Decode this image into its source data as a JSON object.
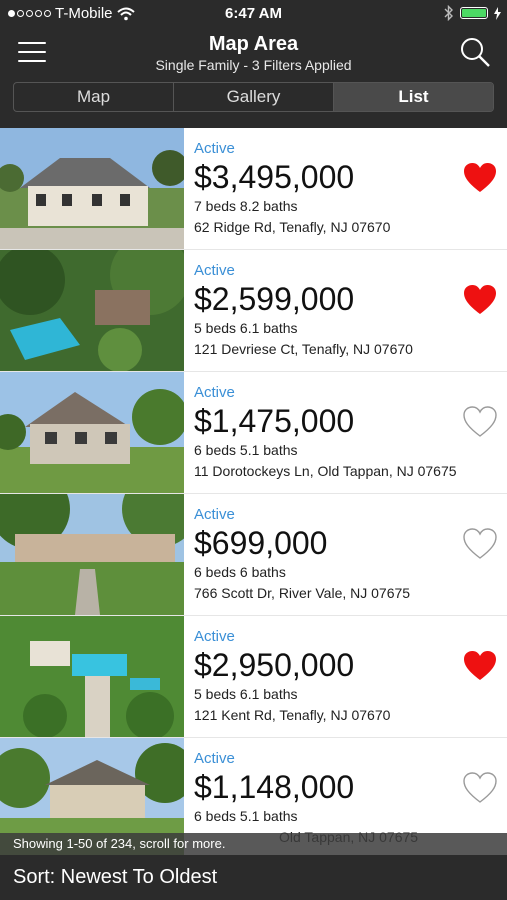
{
  "status_bar": {
    "carrier": "T-Mobile",
    "time": "6:47 AM"
  },
  "header": {
    "title": "Map Area",
    "subtitle": "Single Family - 3 Filters Applied",
    "tabs": [
      {
        "label": "Map",
        "selected": false
      },
      {
        "label": "Gallery",
        "selected": false
      },
      {
        "label": "List",
        "selected": true
      }
    ]
  },
  "listings": [
    {
      "status": "Active",
      "price": "$3,495,000",
      "beds_baths": "7 beds 8.2 baths",
      "address": "62 Ridge Rd, Tenafly, NJ 07670",
      "favorite": true
    },
    {
      "status": "Active",
      "price": "$2,599,000",
      "beds_baths": "5 beds 6.1 baths",
      "address": "121 Devriese Ct, Tenafly, NJ 07670",
      "favorite": true
    },
    {
      "status": "Active",
      "price": "$1,475,000",
      "beds_baths": "6 beds 5.1 baths",
      "address": "11 Dorotockeys Ln, Old Tappan, NJ 07675",
      "favorite": false
    },
    {
      "status": "Active",
      "price": "$699,000",
      "beds_baths": "6 beds 6 baths",
      "address": "766 Scott Dr, River Vale, NJ 07675",
      "favorite": false
    },
    {
      "status": "Active",
      "price": "$2,950,000",
      "beds_baths": "5 beds 6.1 baths",
      "address": "121 Kent Rd, Tenafly, NJ 07670",
      "favorite": true
    },
    {
      "status": "Active",
      "price": "$1,148,000",
      "beds_baths": "6 beds 5.1 baths",
      "address": "Old Tappan, NJ 07675",
      "favorite": false
    }
  ],
  "footer": {
    "results_text": "Showing 1-50 of 234, scroll for more.",
    "sort_label": "Sort: Newest To Oldest"
  },
  "colors": {
    "bar": "#2b2b2b",
    "status_blue": "#3a8fd6",
    "heart_red": "#ee1111",
    "battery_green": "#4cd964"
  },
  "icons": [
    "menu-icon",
    "search-icon",
    "heart-filled-icon",
    "heart-outline-icon",
    "wifi-icon",
    "bluetooth-icon",
    "battery-icon"
  ]
}
